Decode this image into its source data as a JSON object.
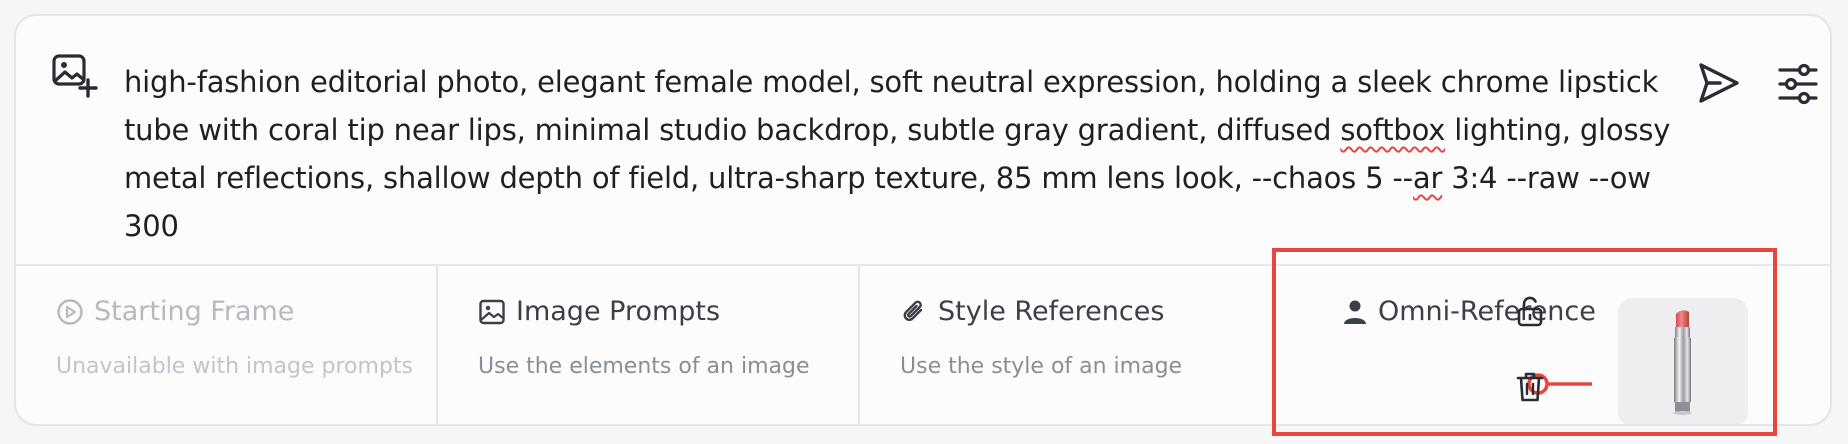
{
  "prompt": {
    "text_before_softbox": "high-fashion editorial photo, elegant female model, soft neutral expression, holding a sleek chrome lipstick tube with coral tip near lips, minimal studio backdrop, subtle gray gradient, diffused ",
    "word_softbox": "softbox",
    "text_mid": " lighting, glossy metal reflections, shallow depth of field, ultra-sharp texture, 85 mm lens look, --chaos 5 --",
    "word_ar": "ar",
    "text_end": " 3:4 --raw --ow 300"
  },
  "tools": {
    "starting_frame": {
      "title": "Starting Frame",
      "subtitle": "Unavailable with image prompts",
      "icon": "play-circle-icon"
    },
    "image_prompts": {
      "title": "Image Prompts",
      "subtitle": "Use the elements of an image",
      "icon": "image-icon"
    },
    "style_references": {
      "title": "Style References",
      "subtitle": "Use the style of an image",
      "icon": "paperclip-icon"
    },
    "omni_reference": {
      "title": "Omni-Reference",
      "icon": "person-icon",
      "weight": 300
    }
  },
  "colors": {
    "accent_red": "#e8463c",
    "text_primary": "#1f2026",
    "text_secondary": "#8a8d99",
    "disabled": "#b7b9c1"
  },
  "icons": [
    "add-image-icon",
    "send-icon",
    "settings-sliders-icon",
    "unlock-icon",
    "trash-icon"
  ]
}
